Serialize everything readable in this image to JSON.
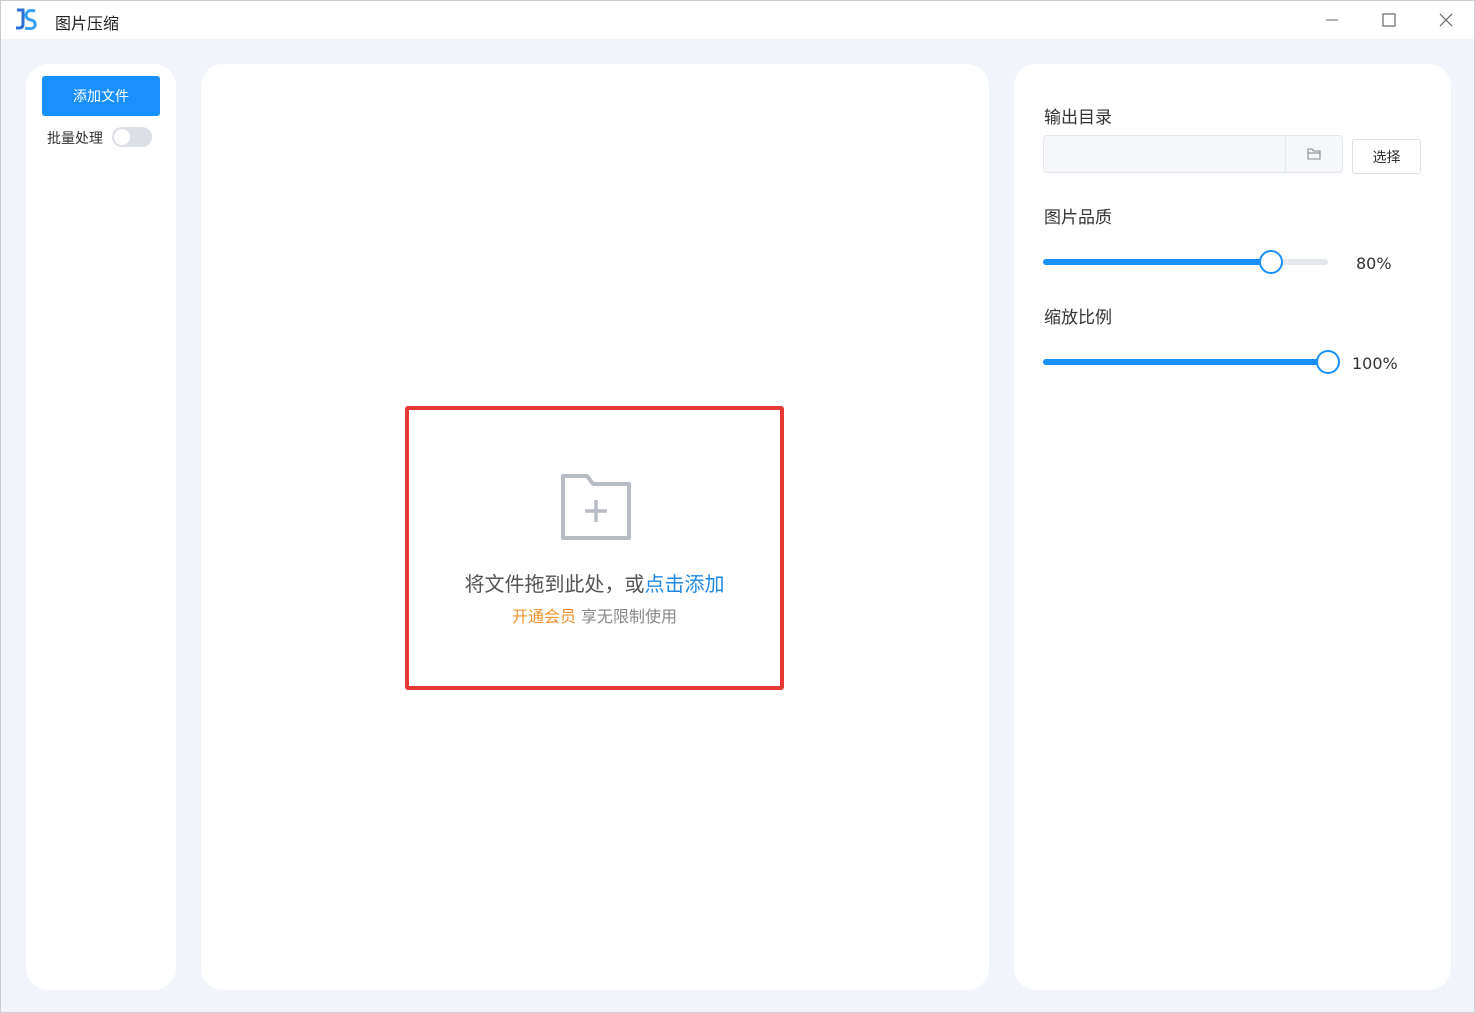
{
  "window": {
    "title": "图片压缩"
  },
  "sidebar": {
    "add_file_label": "添加文件",
    "batch_label": "批量处理",
    "batch_enabled": false
  },
  "dropzone": {
    "main_text": "将文件拖到此处，或",
    "link_text": "点击添加",
    "vip_link": "开通会员",
    "vip_text": " 享无限制使用"
  },
  "settings": {
    "output_dir_label": "输出目录",
    "output_dir_value": "",
    "choose_label": "选择",
    "quality_label": "图片品质",
    "quality_value": 80,
    "quality_text": "80%",
    "scale_label": "缩放比例",
    "scale_value": 100,
    "scale_text": "100%"
  },
  "colors": {
    "accent": "#1890ff",
    "highlight_border": "#e53935",
    "vip": "#f0932b"
  }
}
